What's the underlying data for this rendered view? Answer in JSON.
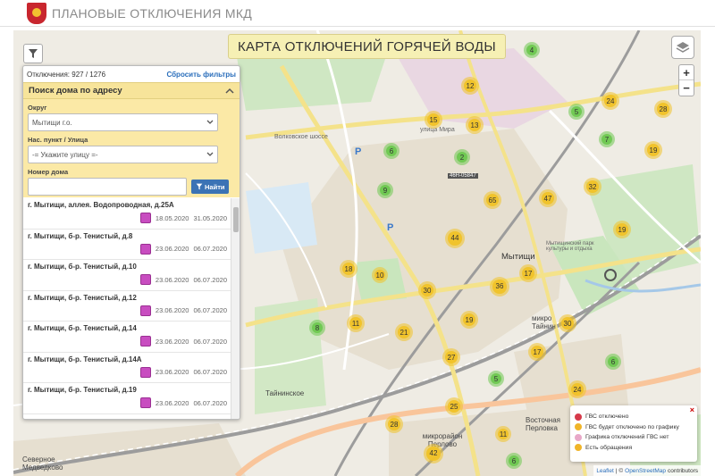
{
  "header": {
    "title": "ПЛАНОВЫЕ ОТКЛЮЧЕНИЯ МКД"
  },
  "map": {
    "title": "КАРТА ОТКЛЮЧЕНИЙ ГОРЯЧЕЙ ВОДЫ",
    "zoom_in": "+",
    "zoom_out": "−",
    "labels": {
      "city": "Мытищи",
      "perlovo": "микрорайон Перлово",
      "tainin": "Тайнинское",
      "vostochnaya": "Восточная Перловка",
      "severnoe": "Северное Медведково",
      "tainin_mkr": "микро Тайнин",
      "shosse": "Волковское шоссе",
      "yaroslavskaya": "улица Мира",
      "park": "Мытищинский парк культуры и отдыха",
      "id": "46Н-05847",
      "p1": "P",
      "p2": "P"
    },
    "clusters": [
      {
        "v": "4",
        "c": "green"
      },
      {
        "v": "12",
        "c": "yellow"
      },
      {
        "v": "15",
        "c": "yellow"
      },
      {
        "v": "13",
        "c": "yellow"
      },
      {
        "v": "5",
        "c": "green"
      },
      {
        "v": "24",
        "c": "yellow"
      },
      {
        "v": "28",
        "c": "yellow"
      },
      {
        "v": "6",
        "c": "green"
      },
      {
        "v": "2",
        "c": "green"
      },
      {
        "v": "7",
        "c": "green"
      },
      {
        "v": "19",
        "c": "yellow"
      },
      {
        "v": "9",
        "c": "green"
      },
      {
        "v": "65",
        "c": "yellow"
      },
      {
        "v": "47",
        "c": "yellow"
      },
      {
        "v": "32",
        "c": "yellow"
      },
      {
        "v": "19",
        "c": "yellow"
      },
      {
        "v": "44",
        "c": "yellow"
      },
      {
        "v": "18",
        "c": "yellow"
      },
      {
        "v": "10",
        "c": "yellow"
      },
      {
        "v": "17",
        "c": "yellow"
      },
      {
        "v": "30",
        "c": "yellow"
      },
      {
        "v": "36",
        "c": "yellow"
      },
      {
        "v": "11",
        "c": "yellow"
      },
      {
        "v": "19",
        "c": "yellow"
      },
      {
        "v": "30",
        "c": "yellow"
      },
      {
        "v": "8",
        "c": "green"
      },
      {
        "v": "21",
        "c": "yellow"
      },
      {
        "v": "27",
        "c": "yellow"
      },
      {
        "v": "17",
        "c": "yellow"
      },
      {
        "v": "6",
        "c": "green"
      },
      {
        "v": "5",
        "c": "green"
      },
      {
        "v": "24",
        "c": "yellow"
      },
      {
        "v": "25",
        "c": "yellow"
      },
      {
        "v": "28",
        "c": "yellow"
      },
      {
        "v": "11",
        "c": "yellow"
      },
      {
        "v": "42",
        "c": "yellow"
      },
      {
        "v": "6",
        "c": "green"
      }
    ]
  },
  "panel": {
    "count": "Отключения: 927 / 1276",
    "reset": "Сбросить фильтры",
    "search_title": "Поиск дома по адресу",
    "district_label": "Округ",
    "district_value": "Мытищи г.о.",
    "street_label": "Нас. пункт / Улица",
    "street_value": "-= Укажите улицу =-",
    "house_label": "Номер дома",
    "find_button": "Найти",
    "results": [
      {
        "addr": "г. Мытищи, аллея. Водопроводная, д.25А",
        "from": "18.05.2020",
        "to": "31.05.2020"
      },
      {
        "addr": "г. Мытищи, б-р. Тенистый, д.8",
        "from": "23.06.2020",
        "to": "06.07.2020"
      },
      {
        "addr": "г. Мытищи, б-р. Тенистый, д.10",
        "from": "23.06.2020",
        "to": "06.07.2020"
      },
      {
        "addr": "г. Мытищи, б-р. Тенистый, д.12",
        "from": "23.06.2020",
        "to": "06.07.2020"
      },
      {
        "addr": "г. Мытищи, б-р. Тенистый, д.14",
        "from": "23.06.2020",
        "to": "06.07.2020"
      },
      {
        "addr": "г. Мытищи, б-р. Тенистый, д.14А",
        "from": "23.06.2020",
        "to": "06.07.2020"
      },
      {
        "addr": "г. Мытищи, б-р. Тенистый, д.19",
        "from": "23.06.2020",
        "to": "06.07.2020"
      }
    ]
  },
  "legend": {
    "close": "×",
    "items": [
      {
        "label": "ГВС отключено",
        "color": "#d63a4a"
      },
      {
        "label": "ГВС будет отключено по графику",
        "color": "#f0b429"
      },
      {
        "label": "Графика отключений ГВС нет",
        "color": "#e8a8c8"
      },
      {
        "label": "Есть обращения",
        "color": "#f0b429"
      }
    ]
  },
  "attribution": {
    "leaflet": "Leaflet",
    "sep": "| ©",
    "osm": "OpenStreetMap",
    "contrib": "contributors"
  },
  "colors": {
    "accent": "#3b73b5",
    "panel_bg": "#fbe9a6",
    "title_bg": "#f6f0b4"
  }
}
